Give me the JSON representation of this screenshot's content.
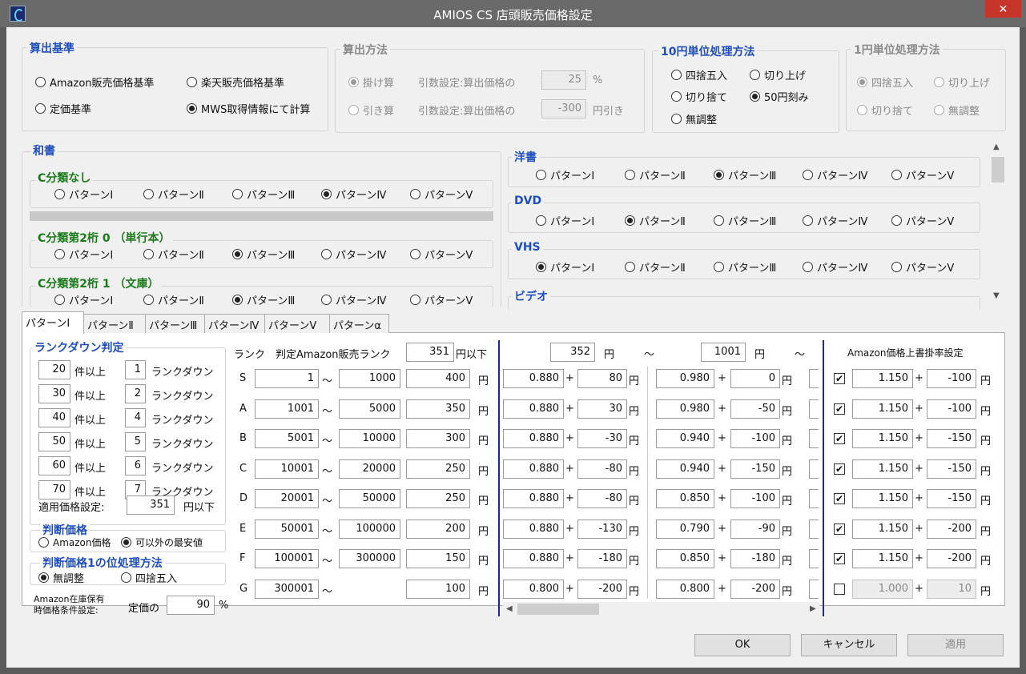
{
  "window": {
    "title": "AMIOS  CS  店頭販売価格設定",
    "close": "✕"
  },
  "santei": {
    "title": "算出基準",
    "opt1": "Amazon販売価格基準",
    "opt2": "楽天販売価格基準",
    "opt3": "定価基準",
    "opt4": "MWS取得情報にて計算",
    "selected": "opt4"
  },
  "houhou": {
    "title": "算出方法",
    "opt1": "掛け算",
    "lbl1": "引数設定:算出価格の",
    "val1": "25",
    "unit1": "%",
    "opt2": "引き算",
    "lbl2": "引数設定:算出価格の",
    "val2": "-300",
    "unit2": "円引き"
  },
  "ten": {
    "title": "10円単位処理方法",
    "opt1": "四捨五入",
    "opt2": "切り上げ",
    "opt3": "切り捨て",
    "opt4": "50円刻み",
    "opt5": "無調整",
    "selected": "opt4"
  },
  "one": {
    "title": "1円単位処理方法",
    "opt1": "四捨五入",
    "opt2": "切り上げ",
    "opt3": "切り捨て",
    "opt4": "無調整"
  },
  "patterns": [
    "パターンⅠ",
    "パターンⅡ",
    "パターンⅢ",
    "パターンⅣ",
    "パターンⅤ"
  ],
  "washo": {
    "title": "和書",
    "groups": [
      {
        "title": "C分類なし",
        "selected": 3
      },
      {
        "title": "C分類第2桁  0 （単行本）",
        "selected": 2
      },
      {
        "title": "C分類第2桁  1 （文庫）",
        "selected": 2
      }
    ]
  },
  "right_groups": [
    {
      "title": "洋書",
      "selected": 2
    },
    {
      "title": "DVD",
      "selected": 1
    },
    {
      "title": "VHS",
      "selected": 0
    },
    {
      "title": "ビデオ",
      "selected": -1
    }
  ],
  "tabs": [
    "パターンⅠ",
    "パターンⅡ",
    "パターンⅢ",
    "パターンⅣ",
    "パターンⅤ",
    "パターンα"
  ],
  "rankdown": {
    "title": "ランクダウン判定",
    "rows": [
      {
        "v": "20",
        "l1": "件以上",
        "n": "1",
        "l2": "ランクダウン"
      },
      {
        "v": "30",
        "l1": "件以上",
        "n": "2",
        "l2": "ランクダウン"
      },
      {
        "v": "40",
        "l1": "件以上",
        "n": "4",
        "l2": "ランクダウン"
      },
      {
        "v": "50",
        "l1": "件以上",
        "n": "5",
        "l2": "ランクダウン"
      },
      {
        "v": "60",
        "l1": "件以上",
        "n": "6",
        "l2": "ランクダウン"
      },
      {
        "v": "70",
        "l1": "件以上",
        "n": "7",
        "l2": "ランクダウン"
      }
    ],
    "apply_label": "適用価格設定:",
    "apply_value": "351",
    "apply_unit": "円以下"
  },
  "handan": {
    "title": "判断価格",
    "opt1": "Amazon価格",
    "opt2": "可以外の最安値"
  },
  "handan1": {
    "title": "判断価格1の位処理方法",
    "opt1": "無調整",
    "opt2": "四捨五入"
  },
  "zaiko": {
    "label1": "Amazon在庫保有",
    "label2": "時価格条件設定:",
    "label3": "定価の",
    "value": "90",
    "unit": "%"
  },
  "table": {
    "h_rank": "ランク",
    "h_judge": "判定Amazon販売ランク",
    "h_val": "351",
    "h_unit": "円以下",
    "h_from": "352",
    "h_from_unit": "円",
    "tilde": "～",
    "h_to": "1001",
    "h_to_unit": "円",
    "h_tilde2": "～",
    "h_amazon": "Amazon価格上書掛率設定",
    "yen": "円",
    "plus": "+",
    "rows": [
      {
        "r": "S",
        "from": "1",
        "to": "1000",
        "price": "400",
        "m1": "0.880",
        "a1": "80",
        "m2": "0.980",
        "a2": "0",
        "ck": true,
        "m3": "1.150",
        "a3": "-100"
      },
      {
        "r": "A",
        "from": "1001",
        "to": "5000",
        "price": "350",
        "m1": "0.880",
        "a1": "30",
        "m2": "0.980",
        "a2": "-50",
        "ck": true,
        "m3": "1.150",
        "a3": "-100"
      },
      {
        "r": "B",
        "from": "5001",
        "to": "10000",
        "price": "300",
        "m1": "0.880",
        "a1": "-30",
        "m2": "0.940",
        "a2": "-100",
        "ck": true,
        "m3": "1.150",
        "a3": "-150"
      },
      {
        "r": "C",
        "from": "10001",
        "to": "20000",
        "price": "250",
        "m1": "0.880",
        "a1": "-80",
        "m2": "0.940",
        "a2": "-150",
        "ck": true,
        "m3": "1.150",
        "a3": "-150"
      },
      {
        "r": "D",
        "from": "20001",
        "to": "50000",
        "price": "250",
        "m1": "0.880",
        "a1": "-80",
        "m2": "0.850",
        "a2": "-100",
        "ck": true,
        "m3": "1.150",
        "a3": "-150"
      },
      {
        "r": "E",
        "from": "50001",
        "to": "100000",
        "price": "200",
        "m1": "0.880",
        "a1": "-130",
        "m2": "0.790",
        "a2": "-90",
        "ck": true,
        "m3": "1.150",
        "a3": "-200"
      },
      {
        "r": "F",
        "from": "100001",
        "to": "300000",
        "price": "150",
        "m1": "0.880",
        "a1": "-180",
        "m2": "0.850",
        "a2": "-180",
        "ck": true,
        "m3": "1.150",
        "a3": "-200"
      },
      {
        "r": "G",
        "from": "300001",
        "to": "",
        "price": "100",
        "m1": "0.800",
        "a1": "-200",
        "m2": "0.800",
        "a2": "-200",
        "ck": false,
        "m3": "1.000",
        "a3": "10"
      }
    ]
  },
  "buttons": {
    "ok": "OK",
    "cancel": "キャンセル",
    "apply": "適用"
  }
}
